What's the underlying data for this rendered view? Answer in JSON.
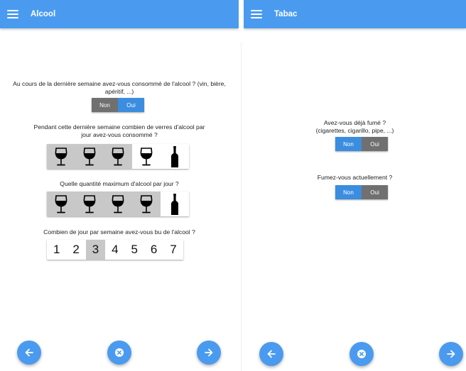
{
  "left": {
    "title": "Alcool",
    "q1": {
      "text": "Au cours de la dernière semaine avez-vous consommé de l'alcool ? (vin, bière, apéritif, ...)",
      "no": "Non",
      "yes": "Oui",
      "selected": "Oui"
    },
    "q2": {
      "text": "Pendant cette dernière semaine combien de verres d'alcool par jour avez-vous consommé ?",
      "selected_glasses": 3,
      "options": [
        "wine-glass",
        "wine-glass",
        "wine-glass",
        "wine-glass",
        "bottle"
      ]
    },
    "q3": {
      "text": "Quelle quantité maximum d'alcool par jour ?",
      "selected_glasses": 4,
      "options": [
        "wine-glass",
        "wine-glass",
        "wine-glass",
        "wine-glass",
        "bottle"
      ]
    },
    "q4": {
      "text": "Combien de jour par semaine avez-vous bu de l'alcool ?",
      "days": [
        "1",
        "2",
        "3",
        "4",
        "5",
        "6",
        "7"
      ],
      "selected": "3"
    },
    "nav": {
      "back": "arrow-left-icon",
      "cancel": "close-icon",
      "next": "arrow-right-icon"
    }
  },
  "right": {
    "title": "Tabac",
    "q1": {
      "line1": "Avez-vous déjà fumé ?",
      "line2": "(cigarettes, cigarillo, pipe, ...)",
      "no": "Non",
      "yes": "Oui",
      "selected": "Non"
    },
    "q2": {
      "text": "Fumez-vous actuellement ?",
      "no": "Non",
      "yes": "Oui",
      "selected": "Non"
    },
    "nav": {
      "back": "arrow-left-icon",
      "cancel": "close-icon",
      "next": "arrow-right-icon"
    }
  },
  "colors": {
    "primary": "#4a9bf0",
    "toggle_on": "#3b8de0",
    "toggle_off": "#707070",
    "selected_cell": "#c8c8c8"
  }
}
